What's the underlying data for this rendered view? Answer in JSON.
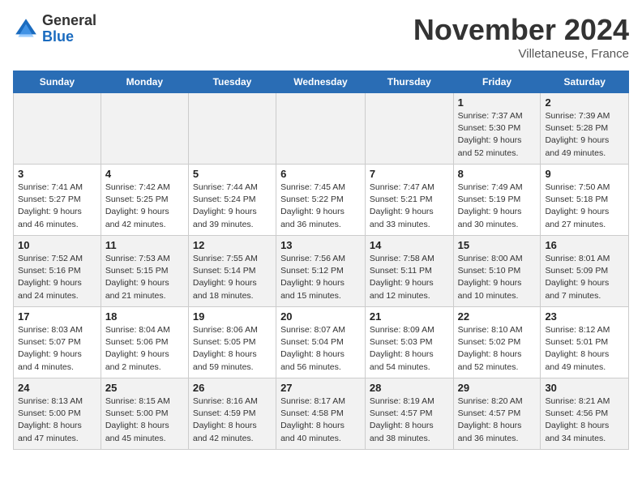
{
  "header": {
    "logo_general": "General",
    "logo_blue": "Blue",
    "month_title": "November 2024",
    "location": "Villetaneuse, France"
  },
  "weekdays": [
    "Sunday",
    "Monday",
    "Tuesday",
    "Wednesday",
    "Thursday",
    "Friday",
    "Saturday"
  ],
  "weeks": [
    [
      {
        "day": "",
        "info": ""
      },
      {
        "day": "",
        "info": ""
      },
      {
        "day": "",
        "info": ""
      },
      {
        "day": "",
        "info": ""
      },
      {
        "day": "",
        "info": ""
      },
      {
        "day": "1",
        "info": "Sunrise: 7:37 AM\nSunset: 5:30 PM\nDaylight: 9 hours and 52 minutes."
      },
      {
        "day": "2",
        "info": "Sunrise: 7:39 AM\nSunset: 5:28 PM\nDaylight: 9 hours and 49 minutes."
      }
    ],
    [
      {
        "day": "3",
        "info": "Sunrise: 7:41 AM\nSunset: 5:27 PM\nDaylight: 9 hours and 46 minutes."
      },
      {
        "day": "4",
        "info": "Sunrise: 7:42 AM\nSunset: 5:25 PM\nDaylight: 9 hours and 42 minutes."
      },
      {
        "day": "5",
        "info": "Sunrise: 7:44 AM\nSunset: 5:24 PM\nDaylight: 9 hours and 39 minutes."
      },
      {
        "day": "6",
        "info": "Sunrise: 7:45 AM\nSunset: 5:22 PM\nDaylight: 9 hours and 36 minutes."
      },
      {
        "day": "7",
        "info": "Sunrise: 7:47 AM\nSunset: 5:21 PM\nDaylight: 9 hours and 33 minutes."
      },
      {
        "day": "8",
        "info": "Sunrise: 7:49 AM\nSunset: 5:19 PM\nDaylight: 9 hours and 30 minutes."
      },
      {
        "day": "9",
        "info": "Sunrise: 7:50 AM\nSunset: 5:18 PM\nDaylight: 9 hours and 27 minutes."
      }
    ],
    [
      {
        "day": "10",
        "info": "Sunrise: 7:52 AM\nSunset: 5:16 PM\nDaylight: 9 hours and 24 minutes."
      },
      {
        "day": "11",
        "info": "Sunrise: 7:53 AM\nSunset: 5:15 PM\nDaylight: 9 hours and 21 minutes."
      },
      {
        "day": "12",
        "info": "Sunrise: 7:55 AM\nSunset: 5:14 PM\nDaylight: 9 hours and 18 minutes."
      },
      {
        "day": "13",
        "info": "Sunrise: 7:56 AM\nSunset: 5:12 PM\nDaylight: 9 hours and 15 minutes."
      },
      {
        "day": "14",
        "info": "Sunrise: 7:58 AM\nSunset: 5:11 PM\nDaylight: 9 hours and 12 minutes."
      },
      {
        "day": "15",
        "info": "Sunrise: 8:00 AM\nSunset: 5:10 PM\nDaylight: 9 hours and 10 minutes."
      },
      {
        "day": "16",
        "info": "Sunrise: 8:01 AM\nSunset: 5:09 PM\nDaylight: 9 hours and 7 minutes."
      }
    ],
    [
      {
        "day": "17",
        "info": "Sunrise: 8:03 AM\nSunset: 5:07 PM\nDaylight: 9 hours and 4 minutes."
      },
      {
        "day": "18",
        "info": "Sunrise: 8:04 AM\nSunset: 5:06 PM\nDaylight: 9 hours and 2 minutes."
      },
      {
        "day": "19",
        "info": "Sunrise: 8:06 AM\nSunset: 5:05 PM\nDaylight: 8 hours and 59 minutes."
      },
      {
        "day": "20",
        "info": "Sunrise: 8:07 AM\nSunset: 5:04 PM\nDaylight: 8 hours and 56 minutes."
      },
      {
        "day": "21",
        "info": "Sunrise: 8:09 AM\nSunset: 5:03 PM\nDaylight: 8 hours and 54 minutes."
      },
      {
        "day": "22",
        "info": "Sunrise: 8:10 AM\nSunset: 5:02 PM\nDaylight: 8 hours and 52 minutes."
      },
      {
        "day": "23",
        "info": "Sunrise: 8:12 AM\nSunset: 5:01 PM\nDaylight: 8 hours and 49 minutes."
      }
    ],
    [
      {
        "day": "24",
        "info": "Sunrise: 8:13 AM\nSunset: 5:00 PM\nDaylight: 8 hours and 47 minutes."
      },
      {
        "day": "25",
        "info": "Sunrise: 8:15 AM\nSunset: 5:00 PM\nDaylight: 8 hours and 45 minutes."
      },
      {
        "day": "26",
        "info": "Sunrise: 8:16 AM\nSunset: 4:59 PM\nDaylight: 8 hours and 42 minutes."
      },
      {
        "day": "27",
        "info": "Sunrise: 8:17 AM\nSunset: 4:58 PM\nDaylight: 8 hours and 40 minutes."
      },
      {
        "day": "28",
        "info": "Sunrise: 8:19 AM\nSunset: 4:57 PM\nDaylight: 8 hours and 38 minutes."
      },
      {
        "day": "29",
        "info": "Sunrise: 8:20 AM\nSunset: 4:57 PM\nDaylight: 8 hours and 36 minutes."
      },
      {
        "day": "30",
        "info": "Sunrise: 8:21 AM\nSunset: 4:56 PM\nDaylight: 8 hours and 34 minutes."
      }
    ]
  ]
}
